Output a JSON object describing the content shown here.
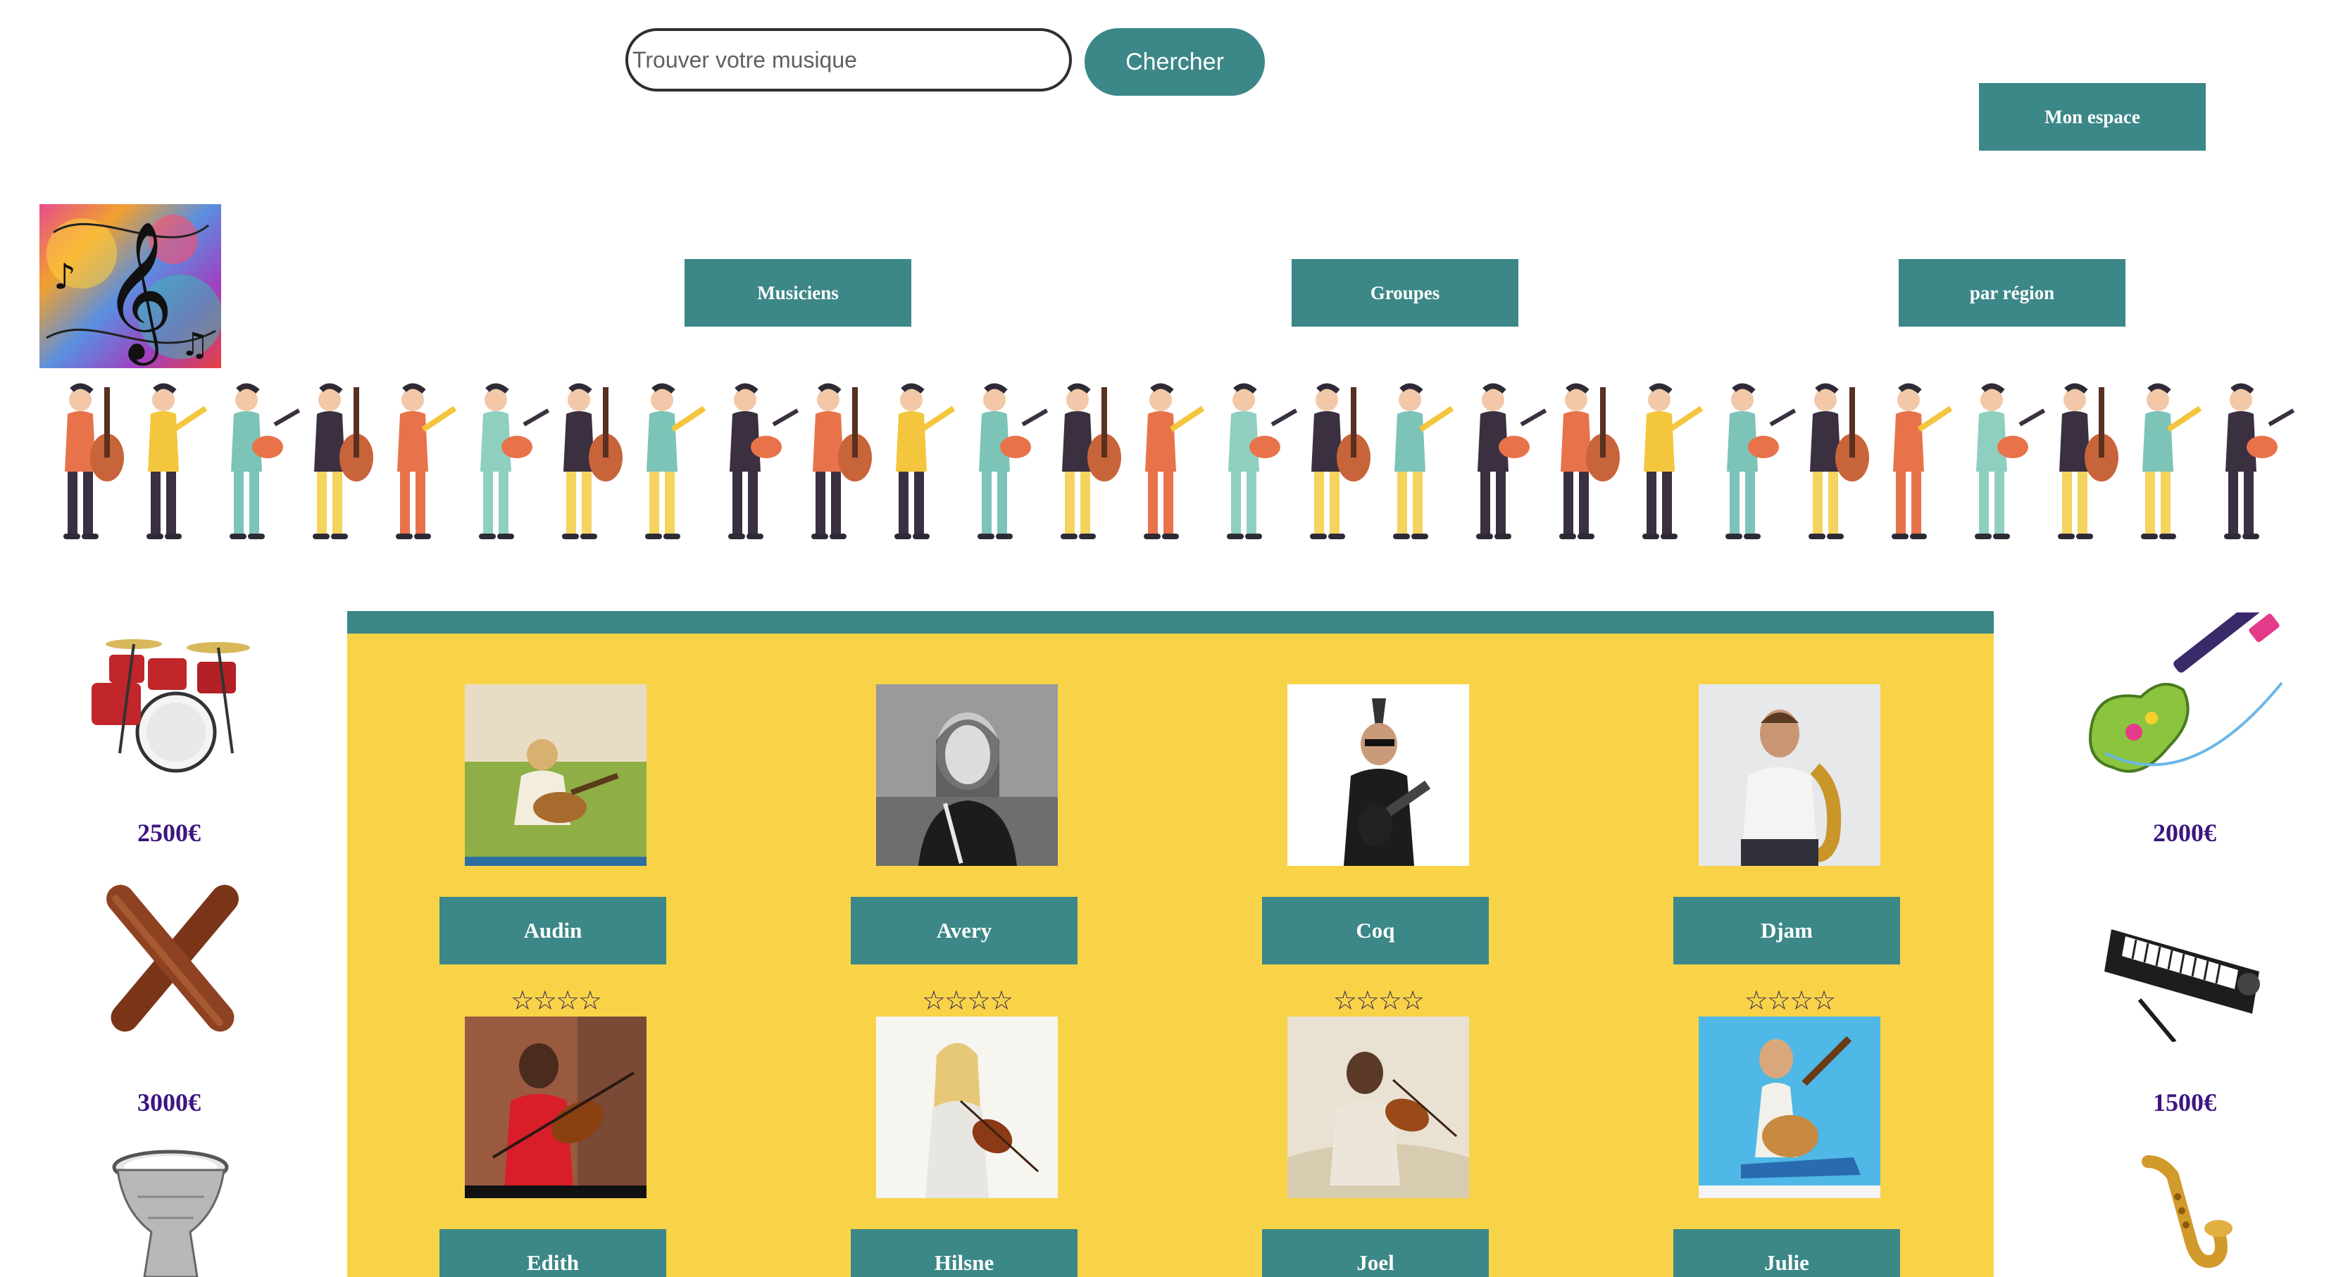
{
  "search": {
    "placeholder": "Trouver votre musique",
    "button_label": "Chercher"
  },
  "header": {
    "account_label": "Mon espace"
  },
  "nav": {
    "musicians": "Musiciens",
    "groups": "Groupes",
    "region": "par région"
  },
  "musicians": [
    {
      "name": "Audin",
      "rating_stars": "☆☆☆☆"
    },
    {
      "name": "Avery",
      "rating_stars": "☆☆☆☆"
    },
    {
      "name": "Coq",
      "rating_stars": "☆☆☆☆"
    },
    {
      "name": "Djam",
      "rating_stars": "☆☆☆☆"
    },
    {
      "name": "Edith"
    },
    {
      "name": "Hilsne"
    },
    {
      "name": "Joel"
    },
    {
      "name": "Julie"
    }
  ],
  "left_products": [
    {
      "icon": "drum-kit-icon",
      "price": "2500€"
    },
    {
      "icon": "claves-icon",
      "price": "3000€"
    },
    {
      "icon": "darbuka-icon"
    }
  ],
  "right_products": [
    {
      "icon": "toy-guitar-icon",
      "price": "2000€"
    },
    {
      "icon": "keyboard-icon",
      "price": "1500€"
    },
    {
      "icon": "saxophone-icon"
    }
  ],
  "colors": {
    "accent": "#3c8787",
    "panel": "#f8d348",
    "price": "#3d1580"
  }
}
